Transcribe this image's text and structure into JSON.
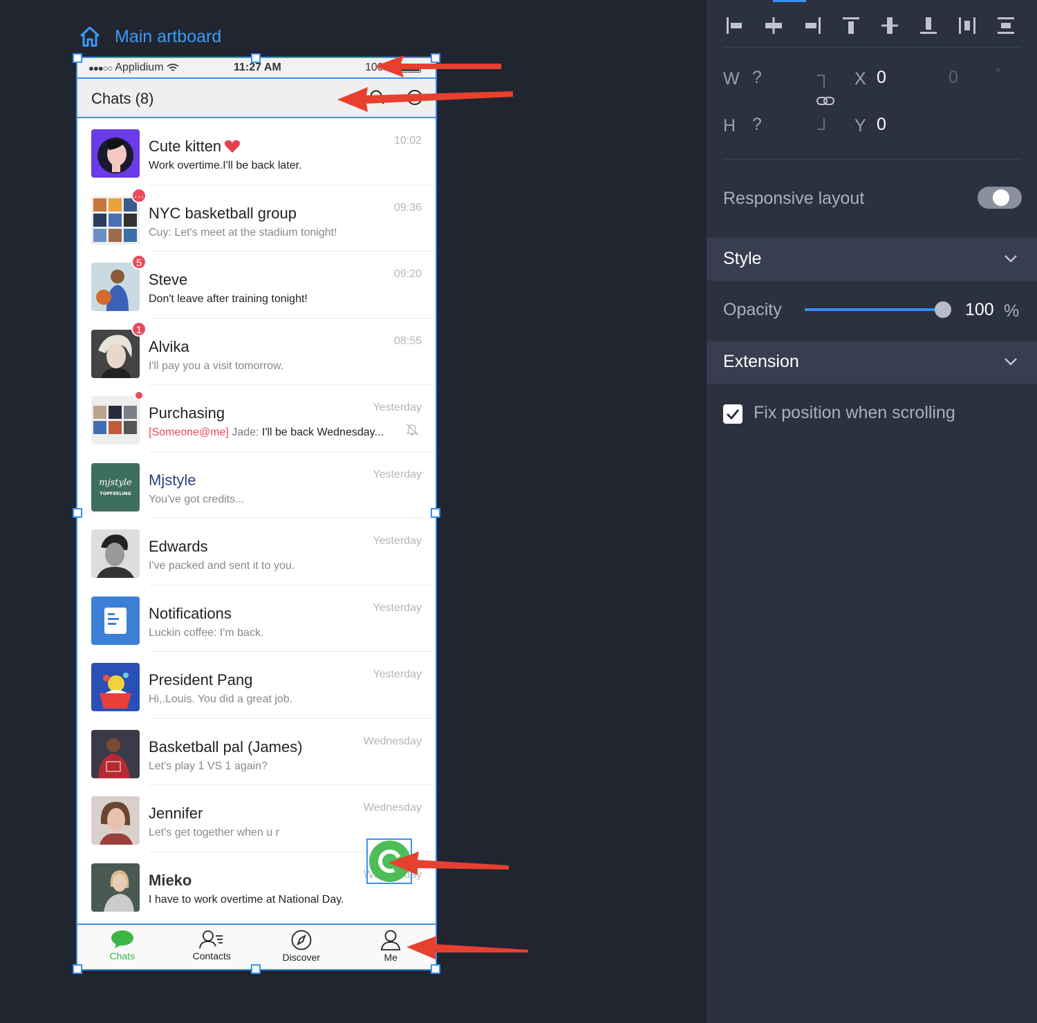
{
  "artboard": {
    "title": "Main artboard"
  },
  "statusbar": {
    "carrier": "Applidium",
    "signal": "●●●○○",
    "time": "11:27 AM",
    "battery": "100%"
  },
  "nav": {
    "title": "Chats (8)"
  },
  "chats": [
    {
      "name": "Cute kitten",
      "message": "Work overtime.I'll be back later.",
      "time": "10:02"
    },
    {
      "name": "NYC basketball group",
      "message": "Cuy: Let's meet at the stadium tonight!",
      "time": "09:36",
      "badge": "···"
    },
    {
      "name": "Steve",
      "message": "Don't leave after training tonight!",
      "time": "09:20",
      "badge": "5"
    },
    {
      "name": "Alvika",
      "message": "I'll pay you a visit tomorrow.",
      "time": "08:55",
      "badge": "1"
    },
    {
      "name": "Purchasing",
      "mention": "[Someone@me]",
      "sender": "Jade:",
      "message": "I'll be back Wednesday...",
      "time": "Yesterday"
    },
    {
      "name": "Mjstyle",
      "message": "You've got credits...",
      "time": "Yesterday",
      "avatar_text": "TOPFEELING",
      "avatar_script": "mjstyle"
    },
    {
      "name": "Edwards",
      "message": "I've packed and sent it to you.",
      "time": "Yesterday"
    },
    {
      "name": "Notifications",
      "message": "Luckin coffee: I'm back.",
      "time": "Yesterday"
    },
    {
      "name": "President Pang",
      "message": "Hi,.Louis. You did a great job.",
      "time": "Yesterday"
    },
    {
      "name": "Basketball pal (James)",
      "message": "Let's play 1 VS 1 again?",
      "time": "Wednesday"
    },
    {
      "name": "Jennifer",
      "message": "Let's get together when u r",
      "time": "Wednesday"
    },
    {
      "name": "Mieko",
      "message": "I have to work overtime at National Day.",
      "time": "Wednesday"
    }
  ],
  "tabs": [
    {
      "label": "Chats",
      "icon": "chat-bubble-icon"
    },
    {
      "label": "Contacts",
      "icon": "contacts-icon"
    },
    {
      "label": "Discover",
      "icon": "compass-icon"
    },
    {
      "label": "Me",
      "icon": "person-icon"
    }
  ],
  "panel": {
    "w_label": "W",
    "w_value": "?",
    "h_label": "H",
    "h_value": "?",
    "x_label": "X",
    "x_value": "0",
    "y_label": "Y",
    "y_value": "0",
    "rotation_value": "0",
    "rotation_unit": "°",
    "responsive_label": "Responsive layout",
    "responsive_on": false,
    "style_label": "Style",
    "opacity_label": "Opacity",
    "opacity_value": "100",
    "opacity_unit": "%",
    "opacity_fraction": 1.0,
    "extension_label": "Extension",
    "fix_position_label": "Fix position when scrolling",
    "fix_position_checked": true
  },
  "colors": {
    "accent": "#3a8ef6",
    "badge": "#ea4b5c",
    "active_tab": "#3cb547",
    "annotation_arrow": "#e8402f",
    "panel_bg": "#2c3140",
    "canvas_bg": "#21252f"
  }
}
